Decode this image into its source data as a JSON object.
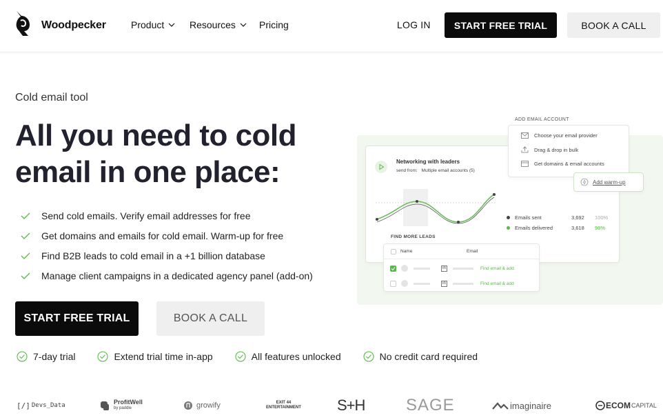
{
  "header": {
    "brand": "Woodpecker",
    "nav": [
      {
        "label": "Product",
        "has_dropdown": true
      },
      {
        "label": "Resources",
        "has_dropdown": true
      },
      {
        "label": "Pricing",
        "has_dropdown": false
      }
    ],
    "login": "LOG IN",
    "trial_button": "START FREE TRIAL",
    "call_button": "BOOK A CALL"
  },
  "hero": {
    "eyebrow": "Cold email tool",
    "headline": "All you need to cold email in one place:",
    "features": [
      "Send cold emails. Verify email addresses for free",
      "Get domains and emails for cold email. Warm-up for free",
      "Find B2B leads to cold email in a +1 billion database",
      "Manage client campaigns in a dedicated agency panel (add-on)"
    ],
    "trial_button": "START FREE TRIAL",
    "call_button": "BOOK A CALL",
    "perks": [
      "7-day trial",
      "Extend trial time in-app",
      "All features unlocked",
      "No credit card required"
    ]
  },
  "illustration": {
    "add_account_title": "ADD EMAIL ACCOUNT",
    "add_account_items": [
      "Choose your email provider",
      "Drag & drop in bulk",
      "Get domains & email accounts"
    ],
    "warmup_label": "Add warm-up",
    "campaign_title": "Networking with leaders",
    "send_from_label": "send from:",
    "send_from_value": "Multiple email accounts (5)",
    "stats": [
      {
        "label": "Emails sent",
        "value": "3,692",
        "pct": "100%"
      },
      {
        "label": "Emails delivered",
        "value": "3,618",
        "pct": "98%"
      }
    ],
    "find_leads_title": "FIND MORE LEADS",
    "columns": [
      "Name",
      "Email"
    ],
    "rows": [
      {
        "checked": true,
        "action": "Find email & add"
      },
      {
        "checked": false,
        "action": "Find email & add"
      }
    ]
  },
  "logos": [
    "Devs_Data",
    "ProfitWell",
    "by paddle",
    "growify",
    "EXIT 44",
    "ENTERTAINMENT",
    "S+H",
    "SAGE",
    "imaginaire",
    "ECOM",
    "CAPITAL"
  ],
  "colors": {
    "accent_green": "#5bb84a",
    "dark": "#0b0b0b",
    "light_button": "#efefef",
    "illustration_bg": "#f2f8ef"
  }
}
